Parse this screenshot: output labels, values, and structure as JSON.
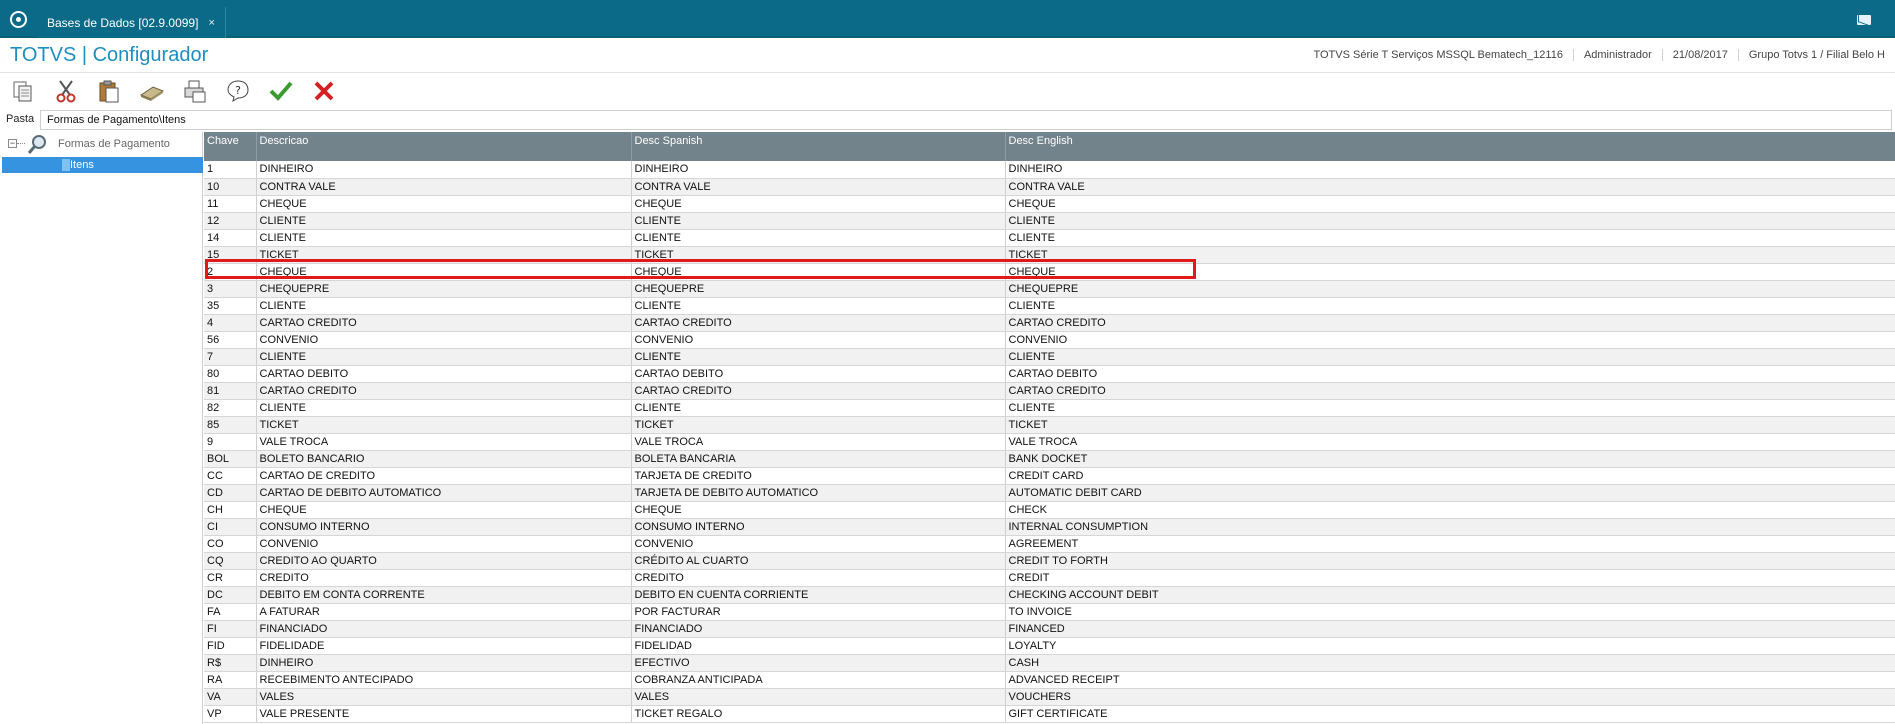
{
  "tab": {
    "label": "Bases de Dados [02.9.0099]",
    "close": "×"
  },
  "header": {
    "title": "TOTVS | Configurador",
    "environment": "TOTVS Série T Serviços MSSQL Bematech_12116",
    "user": "Administrador",
    "date": "21/08/2017",
    "branch": "Grupo Totvs 1 / Filial Belo H"
  },
  "toolbar": {
    "buttons": [
      "copy-icon",
      "cut-icon",
      "paste-icon",
      "eraser-icon",
      "print-icon",
      "help-icon",
      "confirm-icon",
      "cancel-icon"
    ]
  },
  "pasta": {
    "label": "Pasta",
    "value": "Formas de Pagamento\\Itens"
  },
  "tree": {
    "root_label": "Formas de Pagamento",
    "child_label": "Itens"
  },
  "grid": {
    "columns": [
      "Chave",
      "Descricao",
      "Desc Spanish",
      "Desc English"
    ],
    "highlighted_row": 6,
    "rows": [
      [
        "1",
        "DINHEIRO",
        "DINHEIRO",
        "DINHEIRO"
      ],
      [
        "10",
        "CONTRA VALE",
        "CONTRA VALE",
        "CONTRA VALE"
      ],
      [
        "11",
        "CHEQUE",
        "CHEQUE",
        "CHEQUE"
      ],
      [
        "12",
        "CLIENTE",
        "CLIENTE",
        "CLIENTE"
      ],
      [
        "14",
        "CLIENTE",
        "CLIENTE",
        "CLIENTE"
      ],
      [
        "15",
        "TICKET",
        "TICKET",
        "TICKET"
      ],
      [
        "2",
        "CHEQUE",
        "CHEQUE",
        "CHEQUE"
      ],
      [
        "3",
        "CHEQUEPRE",
        "CHEQUEPRE",
        "CHEQUEPRE"
      ],
      [
        "35",
        "CLIENTE",
        "CLIENTE",
        "CLIENTE"
      ],
      [
        "4",
        "CARTAO CREDITO",
        "CARTAO CREDITO",
        "CARTAO CREDITO"
      ],
      [
        "56",
        "CONVENIO",
        "CONVENIO",
        "CONVENIO"
      ],
      [
        "7",
        "CLIENTE",
        "CLIENTE",
        "CLIENTE"
      ],
      [
        "80",
        "CARTAO DEBITO",
        "CARTAO DEBITO",
        "CARTAO DEBITO"
      ],
      [
        "81",
        "CARTAO CREDITO",
        "CARTAO CREDITO",
        "CARTAO CREDITO"
      ],
      [
        "82",
        "CLIENTE",
        "CLIENTE",
        "CLIENTE"
      ],
      [
        "85",
        "TICKET",
        "TICKET",
        "TICKET"
      ],
      [
        "9",
        "VALE TROCA",
        "VALE TROCA",
        "VALE TROCA"
      ],
      [
        "BOL",
        "BOLETO BANCARIO",
        "BOLETA BANCARIA",
        "BANK DOCKET"
      ],
      [
        "CC",
        "CARTAO DE CREDITO",
        "TARJETA DE CREDITO",
        "CREDIT CARD"
      ],
      [
        "CD",
        "CARTAO DE DEBITO AUTOMATICO",
        "TARJETA DE DEBITO AUTOMATICO",
        "AUTOMATIC DEBIT CARD"
      ],
      [
        "CH",
        "CHEQUE",
        "CHEQUE",
        "CHECK"
      ],
      [
        "CI",
        "CONSUMO INTERNO",
        "CONSUMO INTERNO",
        "INTERNAL CONSUMPTION"
      ],
      [
        "CO",
        "CONVENIO",
        "CONVENIO",
        "AGREEMENT"
      ],
      [
        "CQ",
        "CREDITO AO QUARTO",
        "CRÉDITO AL CUARTO",
        "CREDIT TO FORTH"
      ],
      [
        "CR",
        "CREDITO",
        "CREDITO",
        "CREDIT"
      ],
      [
        "DC",
        "DEBITO EM CONTA CORRENTE",
        "DEBITO EN CUENTA CORRIENTE",
        "CHECKING ACCOUNT DEBIT"
      ],
      [
        "FA",
        "A FATURAR",
        "POR FACTURAR",
        "TO INVOICE"
      ],
      [
        "FI",
        "FINANCIADO",
        "FINANCIADO",
        "FINANCED"
      ],
      [
        "FID",
        "FIDELIDADE",
        "FIDELIDAD",
        "LOYALTY"
      ],
      [
        "R$",
        "DINHEIRO",
        "EFECTIVO",
        "CASH"
      ],
      [
        "RA",
        "RECEBIMENTO ANTECIPADO",
        "COBRANZA ANTICIPADA",
        "ADVANCED RECEIPT"
      ],
      [
        "VA",
        "VALES",
        "VALES",
        "VOUCHERS"
      ],
      [
        "VP",
        "VALE PRESENTE",
        "TICKET REGALO",
        "GIFT CERTIFICATE"
      ]
    ]
  }
}
